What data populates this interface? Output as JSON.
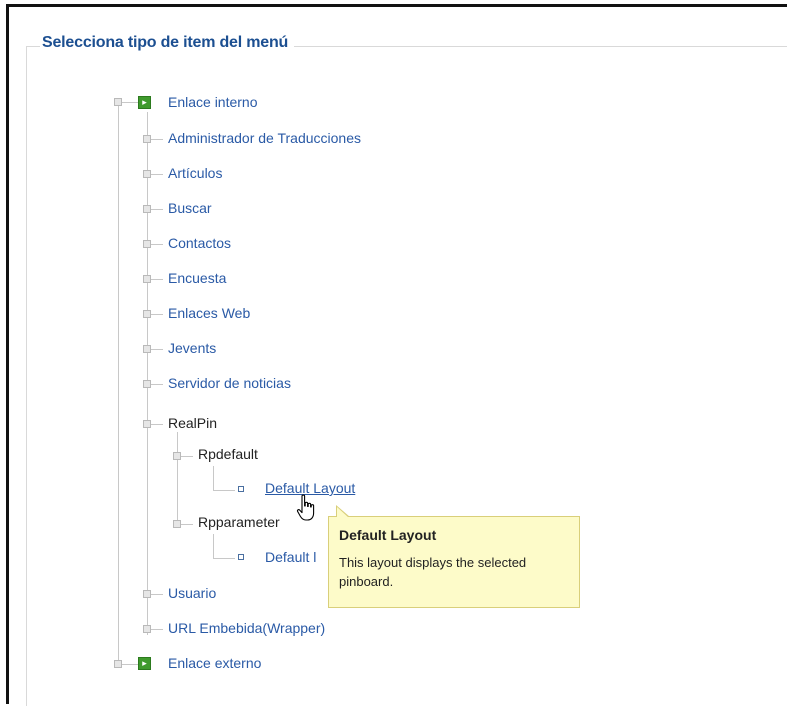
{
  "panel": {
    "legend": "Selecciona tipo de item del menú"
  },
  "tree": {
    "internal": {
      "label": "Enlace interno"
    },
    "items": [
      {
        "label": "Administrador de Traducciones"
      },
      {
        "label": "Artículos"
      },
      {
        "label": "Buscar"
      },
      {
        "label": "Contactos"
      },
      {
        "label": "Encuesta"
      },
      {
        "label": "Enlaces Web"
      },
      {
        "label": "Jevents"
      },
      {
        "label": "Servidor de noticias"
      },
      {
        "label": "RealPin"
      }
    ],
    "realpin": {
      "rpdefault": {
        "label": "Rpdefault",
        "child": "Default Layout"
      },
      "rpparameter": {
        "label": "Rpparameter",
        "child": "Default l"
      }
    },
    "after": [
      {
        "label": "Usuario"
      },
      {
        "label": "URL Embebida(Wrapper)"
      }
    ],
    "external": {
      "label": "Enlace externo"
    }
  },
  "tooltip": {
    "title": "Default Layout",
    "text": "This layout displays the selected pinboard."
  }
}
